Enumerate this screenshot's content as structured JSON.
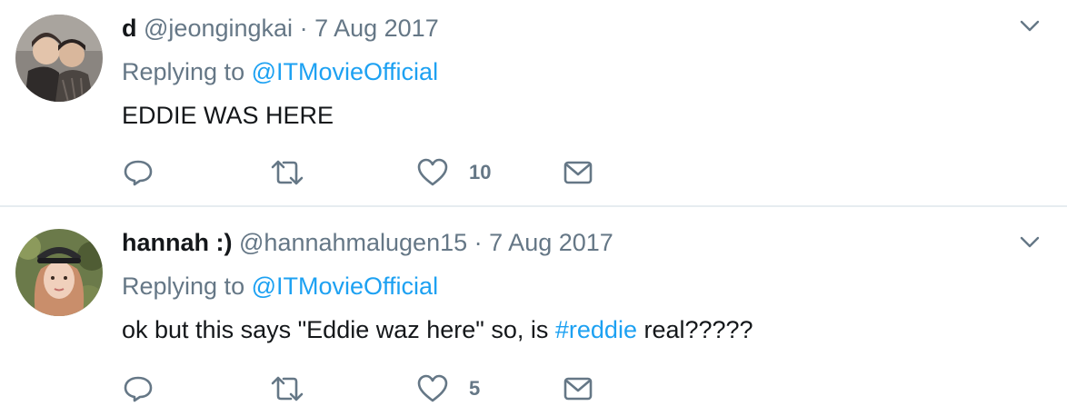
{
  "tweets": [
    {
      "name": "d",
      "handle": "@jeongingkai",
      "separator": "·",
      "date": "7 Aug 2017",
      "replying_label": "Replying to",
      "replying_to": "@ITMovieOfficial",
      "text_parts": [
        "EDDIE WAS HERE"
      ],
      "likes": "10"
    },
    {
      "name": "hannah :)",
      "handle": "@hannahmalugen15",
      "separator": "·",
      "date": "7 Aug 2017",
      "replying_label": "Replying to",
      "replying_to": "@ITMovieOfficial",
      "text_parts": [
        "ok but this says \"Eddie waz here\" so, is ",
        "#reddie",
        " real?????"
      ],
      "likes": "5"
    }
  ],
  "icons": {
    "reply": "reply-icon",
    "retweet": "retweet-icon",
    "like": "heart-icon",
    "dm": "envelope-icon",
    "more": "chevron-down-icon"
  },
  "colors": {
    "link": "#1da1f2",
    "secondary_text": "#657786",
    "divider": "#e6ecf0"
  }
}
